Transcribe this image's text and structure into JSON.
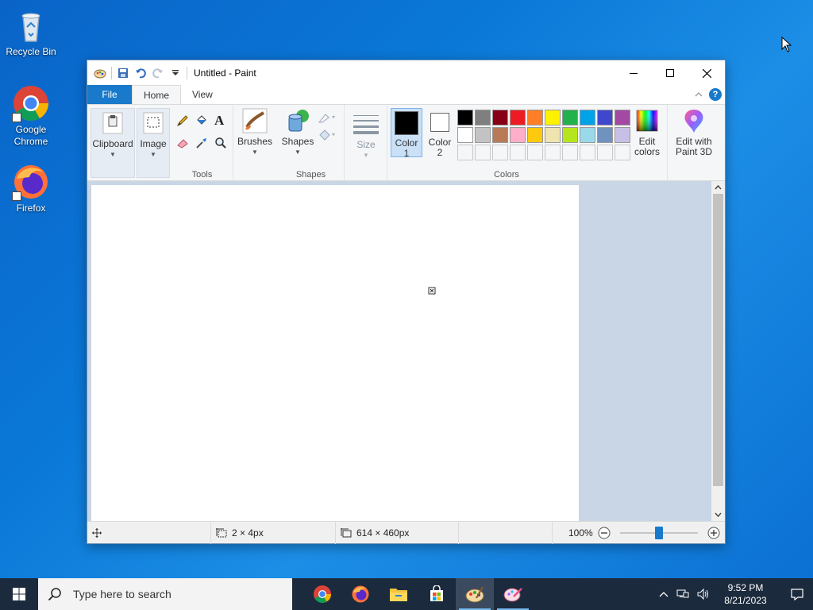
{
  "desktop": {
    "icons": [
      {
        "label": "Recycle Bin",
        "icon": "recycle-bin-icon"
      },
      {
        "label": "Google Chrome",
        "icon": "chrome-icon"
      },
      {
        "label": "Firefox",
        "icon": "firefox-icon"
      }
    ]
  },
  "window": {
    "title": "Untitled - Paint",
    "tabs": {
      "file": "File",
      "home": "Home",
      "view": "View"
    }
  },
  "ribbon": {
    "clipboard": {
      "label": "Clipboard"
    },
    "image": {
      "label": "Image"
    },
    "tools": {
      "group_label": "Tools"
    },
    "brushes": {
      "label": "Brushes"
    },
    "shapes": {
      "label": "Shapes",
      "group_label": "Shapes"
    },
    "size": {
      "label": "Size"
    },
    "color1": {
      "label_line1": "Color",
      "label_line2": "1",
      "value": "#000000"
    },
    "color2": {
      "label_line1": "Color",
      "label_line2": "2",
      "value": "#ffffff"
    },
    "colors": {
      "group_label": "Colors"
    },
    "edit_colors": {
      "line1": "Edit",
      "line2": "colors"
    },
    "paint3d": {
      "line1": "Edit with",
      "line2": "Paint 3D"
    },
    "palette_row1": [
      "#000000",
      "#7f7f7f",
      "#880015",
      "#ed1c24",
      "#ff7f27",
      "#fff200",
      "#22b14c",
      "#00a2e8",
      "#3f48cc",
      "#a349a4"
    ],
    "palette_row2": [
      "#ffffff",
      "#c3c3c3",
      "#b97a57",
      "#ffaec9",
      "#ffc90e",
      "#efe4b0",
      "#b5e61d",
      "#99d9ea",
      "#7092be",
      "#c8bfe7"
    ]
  },
  "status": {
    "selection_size": "2 × 4px",
    "image_size": "614 × 460px",
    "zoom": "100%",
    "zoom_fraction": 0.5
  },
  "taskbar": {
    "search_placeholder": "Type here to search",
    "time": "9:52 PM",
    "date": "8/21/2023"
  }
}
